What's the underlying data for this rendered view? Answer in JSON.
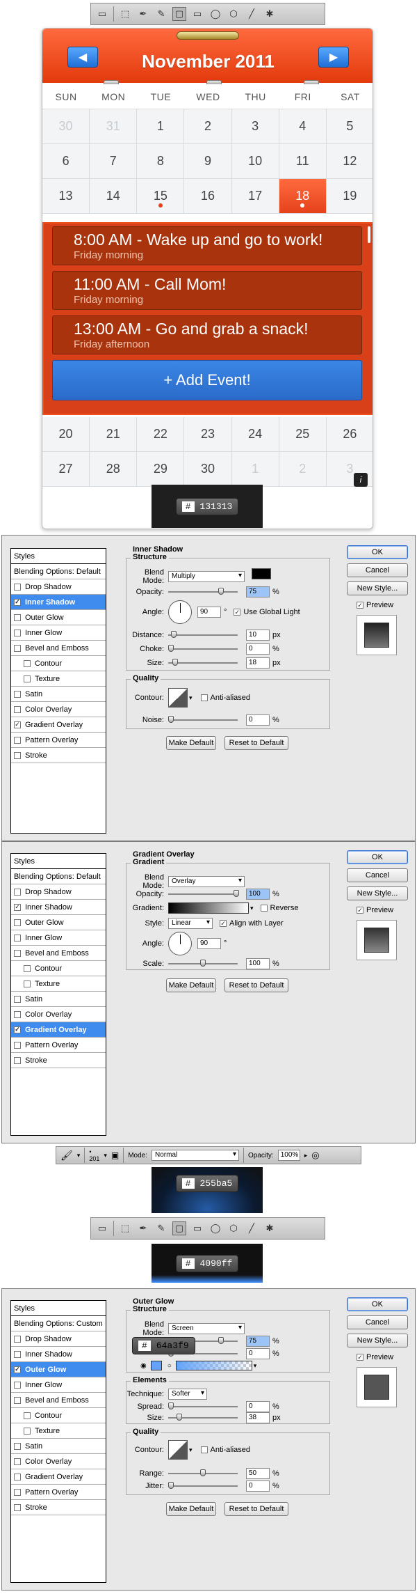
{
  "toolbar": {
    "icons": [
      "marquee-icon",
      "rect-select-icon",
      "pen-icon",
      "freeform-pen-icon",
      "rectangle-icon",
      "rounded-rect-icon",
      "ellipse-icon",
      "polygon-icon",
      "line-icon",
      "custom-shape-icon"
    ]
  },
  "calendar": {
    "month": "November 2011",
    "days_of_week": [
      "SUN",
      "MON",
      "TUE",
      "WED",
      "THU",
      "FRI",
      "SAT"
    ],
    "week1": [
      "30",
      "31",
      "1",
      "2",
      "3",
      "4",
      "5"
    ],
    "week2": [
      "6",
      "7",
      "8",
      "9",
      "10",
      "11",
      "12"
    ],
    "week3": [
      "13",
      "14",
      "15",
      "16",
      "17",
      "18",
      "19"
    ],
    "week4": [
      "20",
      "21",
      "22",
      "23",
      "24",
      "25",
      "26"
    ],
    "week5": [
      "27",
      "28",
      "29",
      "30",
      "1",
      "2",
      "3"
    ],
    "today": "18",
    "events": [
      {
        "title": "8:00 AM - Wake up and go to work!",
        "subtitle": "Friday morning"
      },
      {
        "title": "11:00 AM - Call Mom!",
        "subtitle": "Friday morning"
      },
      {
        "title": "13:00 AM - Go  and grab a snack!",
        "subtitle": "Friday afternoon"
      }
    ],
    "add_event": "+ Add Event!",
    "colors": {
      "header": "#e5421a",
      "event_bg": "#a8330c",
      "add_btn": "#2a6bc9"
    }
  },
  "swatch1": {
    "hash": "#",
    "value": "131313"
  },
  "swatch2": {
    "hash": "#",
    "value": "255ba5"
  },
  "swatch3": {
    "hash": "#",
    "value": "4090ff"
  },
  "swatch4": {
    "hash": "#",
    "value": "64a3f9"
  },
  "dialog1": {
    "styles_header": "Styles",
    "blending": "Blending Options: Default",
    "items": [
      "Drop Shadow",
      "Inner Shadow",
      "Outer Glow",
      "Inner Glow",
      "Bevel and Emboss",
      "Contour",
      "Texture",
      "Satin",
      "Color Overlay",
      "Gradient Overlay",
      "Pattern Overlay",
      "Stroke"
    ],
    "panel_title": "Inner Shadow",
    "structure": "Structure",
    "quality": "Quality",
    "blend_mode_label": "Blend Mode:",
    "blend_mode": "Multiply",
    "opacity_label": "Opacity:",
    "opacity": "75",
    "pct": "%",
    "angle_label": "Angle:",
    "angle": "90",
    "deg": "°",
    "global_light": "Use Global Light",
    "distance_label": "Distance:",
    "distance": "10",
    "px": "px",
    "choke_label": "Choke:",
    "choke": "0",
    "size_label": "Size:",
    "size": "18",
    "contour_label": "Contour:",
    "anti_aliased": "Anti-aliased",
    "noise_label": "Noise:",
    "noise": "0",
    "make_default": "Make Default",
    "reset_default": "Reset to Default",
    "ok": "OK",
    "cancel": "Cancel",
    "new_style": "New Style...",
    "preview": "Preview"
  },
  "dialog2": {
    "styles_header": "Styles",
    "blending": "Blending Options: Default",
    "items": [
      "Drop Shadow",
      "Inner Shadow",
      "Outer Glow",
      "Inner Glow",
      "Bevel and Emboss",
      "Contour",
      "Texture",
      "Satin",
      "Color Overlay",
      "Gradient Overlay",
      "Pattern Overlay",
      "Stroke"
    ],
    "panel_title": "Gradient Overlay",
    "gradient_section": "Gradient",
    "blend_mode_label": "Blend Mode:",
    "blend_mode": "Overlay",
    "opacity_label": "Opacity:",
    "opacity": "100",
    "pct": "%",
    "gradient_label": "Gradient:",
    "reverse": "Reverse",
    "style_label": "Style:",
    "style": "Linear",
    "align": "Align with Layer",
    "angle_label": "Angle:",
    "angle": "90",
    "deg": "°",
    "scale_label": "Scale:",
    "scale": "100",
    "make_default": "Make Default",
    "reset_default": "Reset to Default",
    "ok": "OK",
    "cancel": "Cancel",
    "new_style": "New Style...",
    "preview": "Preview"
  },
  "brushbar": {
    "size": "201",
    "mode_label": "Mode:",
    "mode": "Normal",
    "opacity_label": "Opacity:",
    "opacity": "100%"
  },
  "dialog3": {
    "styles_header": "Styles",
    "blending": "Blending Options: Custom",
    "items": [
      "Drop Shadow",
      "Inner Shadow",
      "Outer Glow",
      "Inner Glow",
      "Bevel and Emboss",
      "Contour",
      "Texture",
      "Satin",
      "Color Overlay",
      "Gradient Overlay",
      "Pattern Overlay",
      "Stroke"
    ],
    "panel_title": "Outer Glow",
    "structure": "Structure",
    "elements": "Elements",
    "quality": "Quality",
    "blend_mode_label": "Blend Mode:",
    "blend_mode": "Screen",
    "opacity": "75",
    "noise": "0",
    "pct": "%",
    "technique_label": "Technique:",
    "technique": "Softer",
    "spread_label": "Spread:",
    "spread": "0",
    "size_label": "Size:",
    "size": "38",
    "px": "px",
    "contour_label": "Contour:",
    "anti_aliased": "Anti-aliased",
    "range_label": "Range:",
    "range": "50",
    "jitter_label": "Jitter:",
    "jitter": "0",
    "make_default": "Make Default",
    "reset_default": "Reset to Default",
    "ok": "OK",
    "cancel": "Cancel",
    "new_style": "New Style...",
    "preview": "Preview"
  }
}
